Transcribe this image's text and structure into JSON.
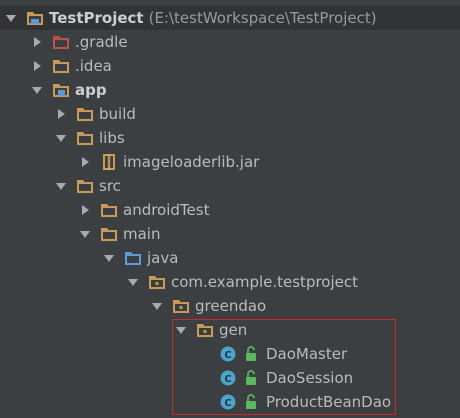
{
  "tree": {
    "root": {
      "name": "TestProject",
      "path": "(E:\\testWorkspace\\TestProject)"
    },
    "items": [
      {
        "label": ".gradle"
      },
      {
        "label": ".idea"
      },
      {
        "label": "app"
      },
      {
        "label": "build"
      },
      {
        "label": "libs"
      },
      {
        "label": "imageloaderlib.jar"
      },
      {
        "label": "src"
      },
      {
        "label": "androidTest"
      },
      {
        "label": "main"
      },
      {
        "label": "java"
      },
      {
        "label": "com.example.testproject"
      },
      {
        "label": "greendao"
      },
      {
        "label": "gen"
      },
      {
        "label": "DaoMaster"
      },
      {
        "label": "DaoSession"
      },
      {
        "label": "ProductBeanDao"
      }
    ]
  },
  "colors": {
    "background": "#3c3f41",
    "folder": "#c99a55",
    "excluded_folder": "#c0504d",
    "source_folder": "#5d9bd5",
    "class_icon": "#4fa3c8",
    "highlight_border": "#cc2a2a"
  }
}
